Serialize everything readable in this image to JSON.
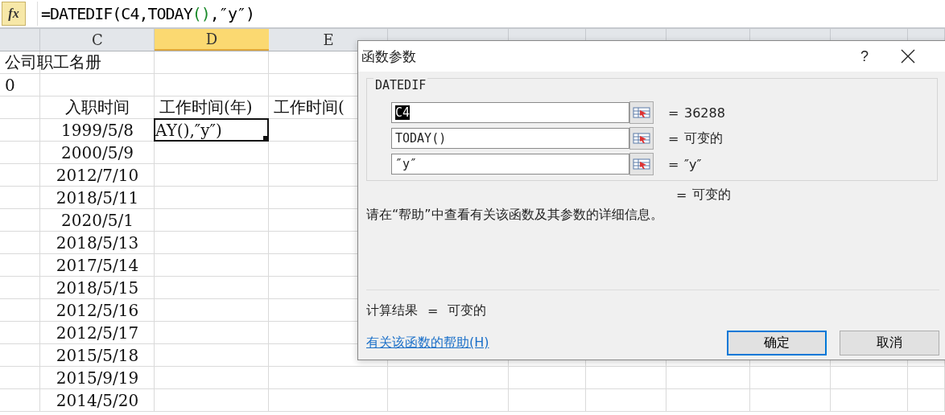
{
  "formula_bar": {
    "fx_label": "fx",
    "formula": [
      {
        "text": "=DATEDIF(C4,TODAY",
        "highlight": false
      },
      {
        "text": "()",
        "highlight": true
      },
      {
        "text": ",″y″)",
        "highlight": false
      }
    ]
  },
  "columns": [
    {
      "label": "C",
      "selected": false
    },
    {
      "label": "D",
      "selected": true
    },
    {
      "label": "E",
      "selected": false
    }
  ],
  "rows": [
    {
      "column_1": {
        "text": "公司职工名册",
        "active": false
      }
    },
    {
      "column_1": {
        "text": "0",
        "active": false
      }
    },
    {
      "C": {
        "text": "入职时间",
        "active": false
      },
      "D": {
        "text": "工作时间(年)",
        "active": false
      },
      "E": {
        "text": "工作时间(",
        "active": false
      }
    },
    {
      "C": {
        "text": "1999/5/8",
        "active": false
      },
      "D": {
        "text": "AY(),″y″)",
        "active": true
      }
    },
    {
      "C": {
        "text": "2000/5/9",
        "active": false
      }
    },
    {
      "C": {
        "text": "2012/7/10",
        "active": false
      }
    },
    {
      "C": {
        "text": "2018/5/11",
        "active": false
      }
    },
    {
      "C": {
        "text": "2020/5/1",
        "active": false
      }
    },
    {
      "C": {
        "text": "2018/5/13",
        "active": false
      }
    },
    {
      "C": {
        "text": "2017/5/14",
        "active": false
      }
    },
    {
      "C": {
        "text": "2018/5/15",
        "active": false
      }
    },
    {
      "C": {
        "text": "2012/5/16",
        "active": false
      }
    },
    {
      "C": {
        "text": "2012/5/17",
        "active": false
      }
    },
    {
      "C": {
        "text": "2015/5/18",
        "active": false
      }
    },
    {
      "C": {
        "text": "2015/9/19",
        "active": false
      }
    },
    {
      "C": {
        "text": "2014/5/20",
        "active": false
      }
    }
  ],
  "dialog": {
    "title": "函数参数",
    "help_button": "?",
    "group_label": "DATEDIF",
    "arguments": [
      {
        "value": "C4",
        "text_selected": true,
        "equals": "=",
        "result": "36288"
      },
      {
        "value": "TODAY()",
        "text_selected": false,
        "equals": "=",
        "result": "可变的"
      },
      {
        "value": "″y″",
        "text_selected": false,
        "equals": "=",
        "result": "″y″"
      }
    ],
    "function_result": {
      "equals": "=",
      "value": "可变的"
    },
    "description": "请在“帮助”中查看有关该函数及其参数的详细信息。",
    "formula_result": {
      "label": "计算结果",
      "equals": "=",
      "value": "可变的"
    },
    "help_link": "有关该函数的帮助(H)",
    "buttons": [
      {
        "label": "确定",
        "focused": true
      },
      {
        "label": "取消",
        "focused": false
      }
    ]
  }
}
